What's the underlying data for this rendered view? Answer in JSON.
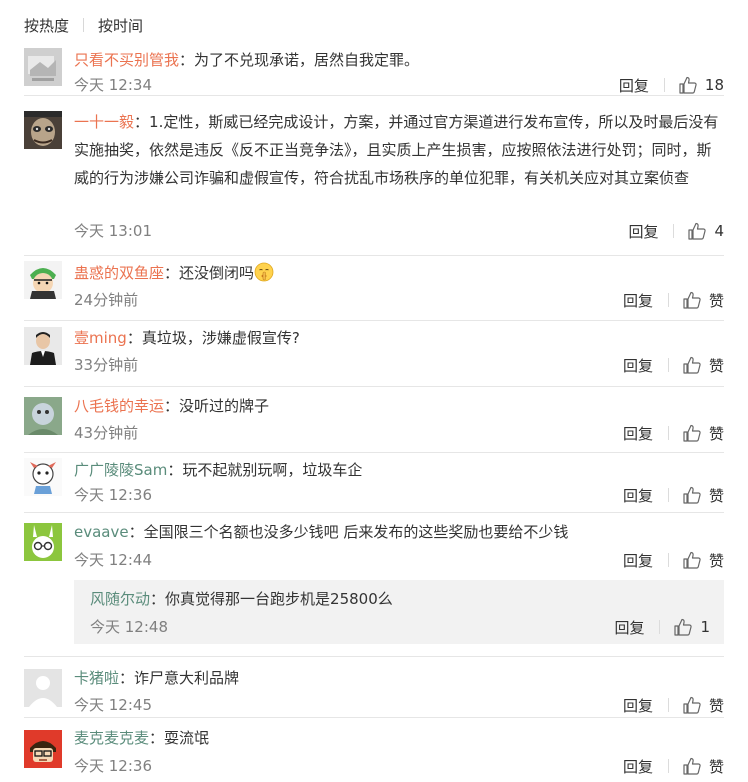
{
  "tabs": {
    "hot": "按热度",
    "time": "按时间"
  },
  "comments": [
    {
      "user": "只看不买别管我",
      "sep": "：",
      "text": "为了不兑现承诺，居然自我定罪。",
      "time": "今天 12:34",
      "reply": "回复",
      "likes": "18"
    },
    {
      "user": "一十一毅",
      "sep": "：",
      "text": "1.定性，斯威已经完成设计，方案，并通过官方渠道进行发布宣传，所以及时最后没有实施抽奖，依然是违反《反不正当竞争法》，且实质上产生损害，应按照依法进行处罚；同时，斯威的行为涉嫌公司诈骗和虚假宣传，符合扰乱市场秩序的单位犯罪，有关机关应对其立案侦查",
      "time": "今天 13:01",
      "reply": "回复",
      "likes": "4"
    },
    {
      "user": "蛊惑的双鱼座",
      "sep": "：",
      "text": "还没倒闭吗",
      "time": "24分钟前",
      "reply": "回复",
      "likes": "赞"
    },
    {
      "user": "壹ming",
      "sep": "：",
      "text": "真垃圾，涉嫌虚假宣传?",
      "time": "33分钟前",
      "reply": "回复",
      "likes": "赞"
    },
    {
      "user": "八毛钱的幸运",
      "sep": "：",
      "text": "没听过的牌子",
      "time": "43分钟前",
      "reply": "回复",
      "likes": "赞"
    },
    {
      "user": "广广陵陵Sam",
      "sep": "：",
      "text": "玩不起就别玩啊，垃圾车企",
      "time": "今天 12:36",
      "reply": "回复",
      "likes": "赞"
    },
    {
      "user": "evaave",
      "sep": "：",
      "text": "全国限三个名额也没多少钱吧 后来发布的这些奖励也要给不少钱",
      "time": "今天 12:44",
      "reply": "回复",
      "likes": "赞"
    },
    {
      "user": "卡猪啦",
      "sep": "：",
      "text": "诈尸意大利品牌",
      "time": "今天 12:45",
      "reply": "回复",
      "likes": "赞"
    },
    {
      "user": "麦克麦克麦",
      "sep": "：",
      "text": "耍流氓",
      "time": "今天 12:36",
      "reply": "回复",
      "likes": "赞"
    }
  ],
  "sub_reply": {
    "user": "风随尔动",
    "sep": "：",
    "text": "你真觉得那一台跑步机是25800么",
    "time": "今天 12:48",
    "reply": "回复",
    "likes": "1"
  },
  "colors": {
    "username_orange": "#eb7350",
    "username_green": "#5a8c7b",
    "meta_gray": "#808080",
    "reply_bg": "#f2f2f2"
  }
}
